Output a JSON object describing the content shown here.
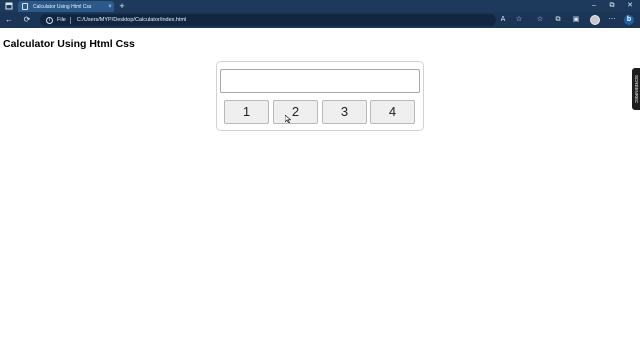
{
  "browser": {
    "tab_title": "Calculator Using Html Css",
    "tab_close": "×",
    "new_tab": "+",
    "minimize": "–",
    "maximize": "⧉",
    "close": "✕",
    "address_prefix": "File",
    "url": "C:/Users/MYP/Desktop/Calculator/index.html",
    "colors": {
      "titlebar": "#1d3a5c",
      "toolbar": "#1a3556",
      "tab_active": "#2b5a8a"
    }
  },
  "page": {
    "title": "Calculator Using Html Css"
  },
  "calculator": {
    "display_value": "",
    "keys": [
      "1",
      "2",
      "3",
      "4"
    ]
  },
  "side_extension_label": "SCREENREC"
}
